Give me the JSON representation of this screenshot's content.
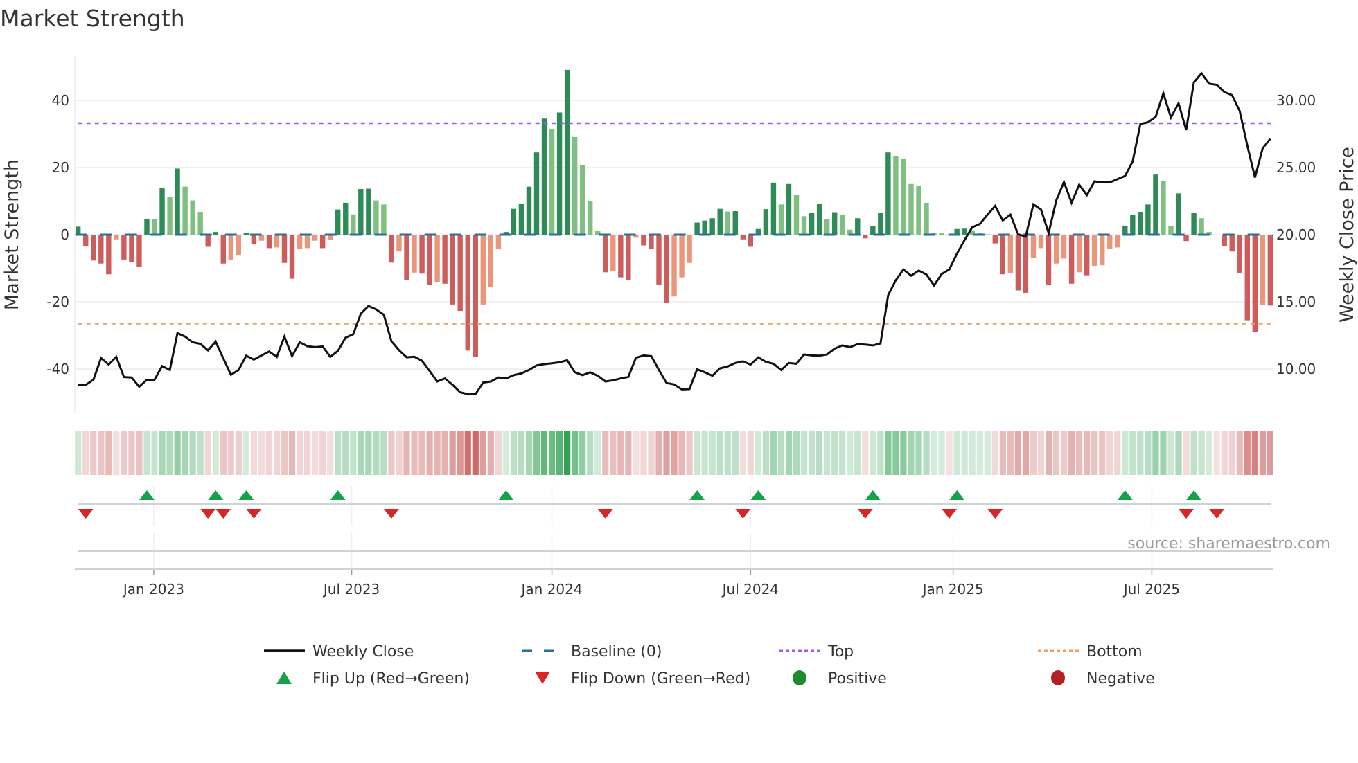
{
  "title": "Market Strength",
  "source": "source: sharemaestro.com",
  "colors": {
    "strong_up": "#2e8b57",
    "weak_up": "#7fbf7f",
    "strong_down": "#cd5c5c",
    "weak_down": "#e9967a",
    "close_line": "#111111",
    "baseline": "#2a6f97",
    "top": "#a05ee0",
    "bottom": "#f0a060",
    "flip_up": "#18a04a",
    "flip_down": "#d62728",
    "positive": "#1f8a2e",
    "negative": "#b22222",
    "grid": "#eef0f4"
  },
  "legend": [
    {
      "label": "Weekly Close",
      "symbol": "line"
    },
    {
      "label": "Baseline (0)",
      "symbol": "dash"
    },
    {
      "label": "Top",
      "symbol": "dot-top"
    },
    {
      "label": "Bottom",
      "symbol": "dot-bottom"
    },
    {
      "label": "Flip Up (Red→Green)",
      "symbol": "tri-up"
    },
    {
      "label": "Flip Down (Green→Red)",
      "symbol": "tri-down"
    },
    {
      "label": "Positive",
      "symbol": "dot-pos"
    },
    {
      "label": "Negative",
      "symbol": "dot-neg"
    }
  ],
  "chart_data": {
    "type": "bar",
    "title": "Market Strength",
    "ylabel": "Market Strength",
    "y2label": "Weekly Close Price",
    "y_ticks": [
      40,
      20,
      0,
      -20,
      -40
    ],
    "y2_ticks": [
      "30.00",
      "25.00",
      "20.00",
      "15.00",
      "10.00"
    ],
    "y2_tick_values": [
      30,
      25,
      20,
      15,
      10
    ],
    "x_ticks": [
      "Jan 2023",
      "Jul 2023",
      "Jan 2024",
      "Jul 2024",
      "Jan 2025",
      "Jul 2025"
    ],
    "x_tick_weeks": [
      9.9,
      35.8,
      62.0,
      88.0,
      114.5,
      140.5
    ],
    "ylim": [
      -52,
      53
    ],
    "y2lim": [
      7,
      33.25
    ],
    "top_threshold": 33.2,
    "bottom_threshold": -26.5,
    "baseline": 0,
    "strength": [
      2.4,
      -3.3,
      -7.7,
      -8.6,
      -11.8,
      -1.4,
      -7.4,
      -8.2,
      -9.6,
      4.7,
      4.7,
      13.8,
      11.3,
      19.7,
      14.3,
      10.2,
      6.8,
      -3.6,
      0.8,
      -8.6,
      -7.5,
      -6.2,
      0.5,
      -2.9,
      -1.8,
      -4.0,
      -3.8,
      -8.4,
      -13.1,
      -4.2,
      -4.0,
      -1.8,
      -4.0,
      -1.6,
      7.5,
      9.5,
      6.0,
      13.6,
      13.7,
      10.2,
      9.0,
      -8.3,
      -5.0,
      -13.6,
      -11.3,
      -11.6,
      -14.9,
      -14.2,
      -14.6,
      -20.8,
      -22.7,
      -34.5,
      -36.4,
      -20.8,
      -15.5,
      -4.2,
      0.8,
      7.7,
      9.2,
      14.3,
      24.5,
      34.6,
      31.5,
      36.4,
      49.1,
      29.1,
      20.8,
      9.9,
      1.2,
      -11.2,
      -10.8,
      -12.7,
      -13.6,
      -0.9,
      -3.2,
      -4.3,
      -14.9,
      -20.2,
      -18.4,
      -12.7,
      -8.4,
      3.6,
      4.2,
      4.9,
      7.7,
      6.9,
      7.0,
      -1.4,
      -3.6,
      1.7,
      7.6,
      15.5,
      9.0,
      15.1,
      11.9,
      5.5,
      6.4,
      9.2,
      4.7,
      6.7,
      5.9,
      1.5,
      4.9,
      -1.1,
      2.6,
      6.5,
      24.5,
      23.3,
      22.7,
      15.1,
      14.6,
      9.5,
      0.6,
      0.4,
      -0.1,
      1.7,
      1.8,
      1.3,
      0.6,
      0.1,
      -2.6,
      -11.8,
      -11.4,
      -16.6,
      -17.3,
      -6.9,
      -4.0,
      -14.9,
      -8.6,
      -7.1,
      -14.6,
      -11.2,
      -12.1,
      -9.3,
      -9.1,
      -4.2,
      -3.8,
      2.7,
      5.9,
      6.8,
      9.0,
      17.9,
      16.0,
      2.5,
      12.3,
      -1.9,
      6.6,
      4.9,
      0.8,
      -0.2,
      -3.5,
      -5.0,
      -11.4,
      -25.5,
      -29.0,
      -21.0,
      -21.1
    ],
    "weekly_close": [
      8.82,
      8.82,
      9.2,
      10.82,
      10.33,
      10.9,
      9.4,
      9.37,
      8.68,
      9.2,
      9.2,
      10.22,
      9.93,
      12.67,
      12.41,
      11.99,
      11.87,
      11.39,
      12.04,
      10.79,
      9.57,
      9.93,
      10.99,
      10.7,
      11.01,
      11.3,
      10.9,
      12.41,
      10.96,
      11.99,
      11.7,
      11.63,
      11.68,
      10.9,
      11.35,
      12.33,
      12.59,
      14.13,
      14.69,
      14.44,
      14.04,
      12.07,
      11.39,
      10.87,
      10.91,
      10.62,
      9.85,
      9.07,
      9.3,
      8.82,
      8.27,
      8.13,
      8.13,
      8.99,
      9.07,
      9.37,
      9.3,
      9.54,
      9.67,
      9.93,
      10.27,
      10.36,
      10.43,
      10.5,
      10.65,
      9.76,
      9.54,
      9.76,
      9.5,
      9.07,
      9.16,
      9.3,
      9.42,
      10.84,
      11.01,
      10.96,
      9.93,
      8.96,
      8.85,
      8.48,
      8.51,
      9.98,
      9.76,
      9.5,
      10.05,
      10.19,
      10.45,
      10.57,
      10.33,
      10.87,
      10.53,
      10.39,
      9.93,
      10.45,
      10.39,
      11.08,
      11.01,
      10.99,
      11.08,
      11.52,
      11.76,
      11.63,
      11.85,
      11.82,
      11.76,
      11.9,
      15.5,
      16.61,
      17.41,
      16.95,
      17.33,
      17.04,
      16.22,
      17.07,
      17.41,
      18.58,
      19.61,
      20.55,
      20.8,
      21.49,
      22.14,
      21.06,
      21.49,
      20.03,
      19.86,
      22.26,
      21.87,
      20.12,
      22.55,
      23.92,
      22.38,
      23.72,
      22.95,
      23.97,
      23.89,
      23.89,
      24.14,
      24.37,
      25.46,
      28.25,
      28.37,
      28.77,
      30.53,
      28.72,
      29.79,
      27.79,
      31.34,
      32.02,
      31.25,
      31.16,
      30.62,
      30.39,
      29.2,
      26.63,
      24.26,
      26.42,
      27.14
    ],
    "flip_up_weeks": [
      9,
      18,
      22,
      34,
      56,
      81,
      89,
      104,
      115,
      137,
      146
    ],
    "flip_down_weeks": [
      1,
      17,
      19,
      23,
      41,
      69,
      87,
      103,
      114,
      120,
      145,
      149
    ],
    "grid": true,
    "legend_position": "bottom"
  }
}
